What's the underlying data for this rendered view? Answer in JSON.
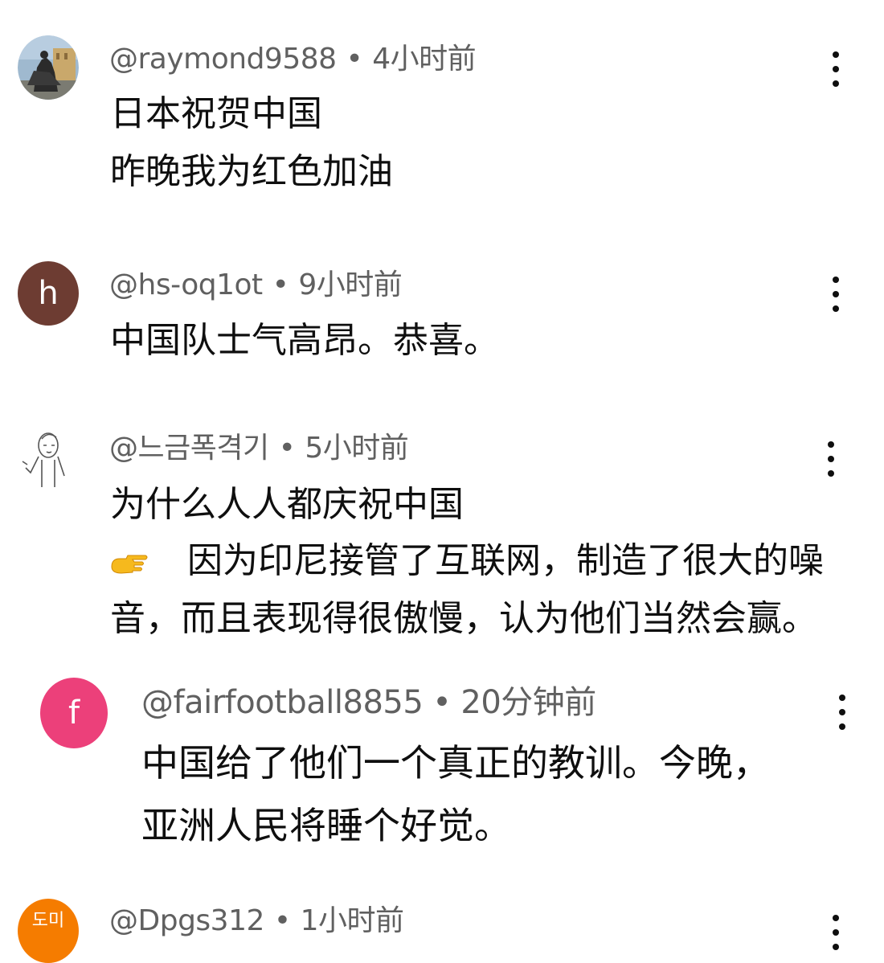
{
  "comments": [
    {
      "handle": "@raymond9588",
      "time": "4小时前",
      "lines": [
        "日本祝贺中国",
        "昨晚我为红色加油"
      ],
      "avatar": {
        "type": "photo",
        "icon": "statue-photo-avatar"
      }
    },
    {
      "handle": "@hs-oq1ot",
      "time": "9小时前",
      "lines": [
        "中国队士气高昂。恭喜。"
      ],
      "avatar": {
        "type": "letter",
        "letter": "h",
        "color": "#6d3c32"
      }
    },
    {
      "handle": "@느금폭격기",
      "time": "5小时前",
      "lines": [
        "为什么人人都庆祝中国",
        "因为印尼接管了互联网，制造了很大的噪",
        "音，而且表现得很傲慢，认为他们当然会赢。"
      ],
      "hand_icon": "pointing-hand-icon",
      "avatar": {
        "type": "sketch",
        "icon": "sketch-avatar"
      }
    },
    {
      "handle": "@fairfootball8855",
      "time": "20分钟前",
      "lines": [
        "中国给了他们一个真正的教训。今晚，",
        "亚洲人民将睡个好觉。"
      ],
      "avatar": {
        "type": "letter",
        "letter": "f",
        "color": "#ec407a"
      },
      "reply": true
    },
    {
      "handle": "@Dpgs312",
      "time": "1小时前",
      "lines": [],
      "avatar": {
        "type": "text",
        "letter": "도미",
        "color": "#f57c00"
      }
    }
  ],
  "separator": "•",
  "more_icon": "more-vertical-icon"
}
